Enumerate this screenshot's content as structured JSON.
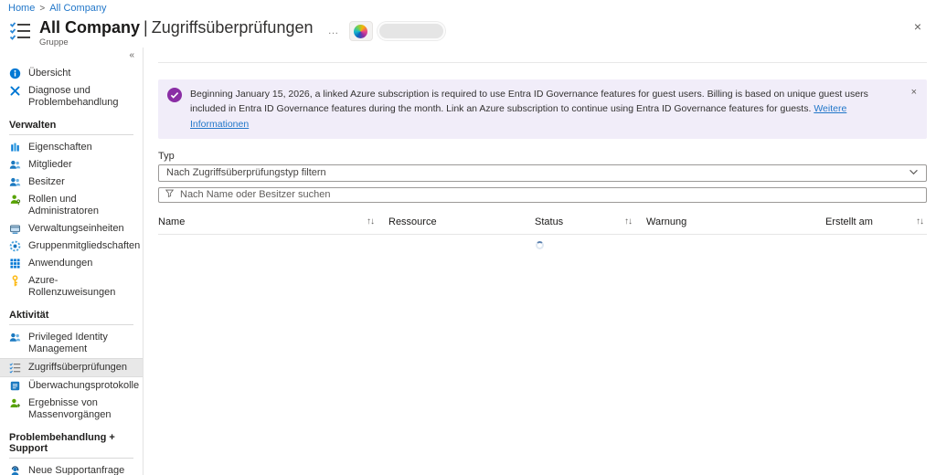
{
  "breadcrumb": {
    "separator": ">",
    "items": [
      {
        "label": "Home"
      },
      {
        "label": "All Company"
      }
    ]
  },
  "header": {
    "title_primary": "All Company",
    "title_divider": "|",
    "title_secondary": "Zugriffsüberprüfungen",
    "subtitle": "Gruppe",
    "more_icon": "…",
    "close_icon": "×"
  },
  "sidebar": {
    "collapse_icon": "«",
    "sections": [
      {
        "header": "",
        "items": [
          {
            "label": "Übersicht",
            "icon": "info-icon"
          },
          {
            "label": "Diagnose und Problembehandlung",
            "icon": "diagnostics-icon"
          }
        ]
      },
      {
        "header": "Verwalten",
        "items": [
          {
            "label": "Eigenschaften",
            "icon": "properties-icon"
          },
          {
            "label": "Mitglieder",
            "icon": "people-icon"
          },
          {
            "label": "Besitzer",
            "icon": "people-icon"
          },
          {
            "label": "Rollen und Administratoren",
            "icon": "person-role-icon"
          },
          {
            "label": "Verwaltungseinheiten",
            "icon": "admin-units-icon"
          },
          {
            "label": "Gruppenmitgliedschaften",
            "icon": "memberships-icon"
          },
          {
            "label": "Anwendungen",
            "icon": "apps-grid-icon"
          },
          {
            "label": "Azure-Rollenzuweisungen",
            "icon": "key-icon"
          }
        ]
      },
      {
        "header": "Aktivität",
        "items": [
          {
            "label": "Privileged Identity Management",
            "icon": "people-icon"
          },
          {
            "label": "Zugriffsüberprüfungen",
            "icon": "checklist-icon",
            "selected": true
          },
          {
            "label": "Überwachungsprotokolle",
            "icon": "audit-log-icon"
          },
          {
            "label": "Ergebnisse von Massenvorgängen",
            "icon": "bulk-results-icon"
          }
        ]
      },
      {
        "header": "Problembehandlung + Support",
        "items": [
          {
            "label": "Neue Supportanfrage",
            "icon": "support-person-icon"
          }
        ]
      }
    ]
  },
  "banner": {
    "text": "Beginning January 15, 2026, a linked Azure subscription is required to use Entra ID Governance features for guest users. Billing is based on unique guest users included in Entra ID Governance features during the month. Link an Azure subscription to continue using Entra ID Governance features for guests.",
    "link_label": "Weitere Informationen",
    "close_icon": "×"
  },
  "filters": {
    "type_label": "Typ",
    "type_placeholder": "Nach Zugriffsüberprüfungstyp filtern",
    "search_placeholder": "Nach Name oder Besitzer suchen"
  },
  "table": {
    "sort_icon": "↑↓",
    "columns": [
      {
        "label": "Name",
        "sortable": true
      },
      {
        "label": "Ressource",
        "sortable": false
      },
      {
        "label": "Status",
        "sortable": true
      },
      {
        "label": "Warnung",
        "sortable": false
      },
      {
        "label": "Erstellt am",
        "sortable": true
      }
    ]
  },
  "colors": {
    "accent": "#0078d4",
    "link": "#2277c9",
    "banner_background": "#f1edf9",
    "banner_icon": "#8a2da5",
    "selected_item_background": "#e8e8e8",
    "key_icon_gold": "#fdb913",
    "person_green": "#57a300"
  }
}
